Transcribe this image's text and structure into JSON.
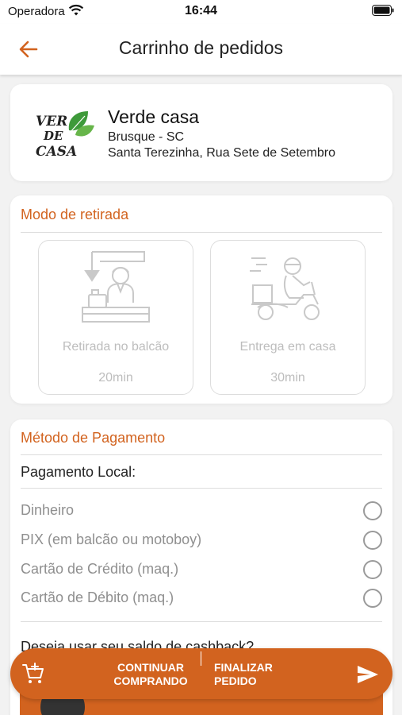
{
  "status_bar": {
    "carrier": "Operadora",
    "time": "16:44"
  },
  "header": {
    "title": "Carrinho de pedidos"
  },
  "store": {
    "logo_line1": "VER",
    "logo_line2": "DE",
    "logo_line3": "CASA",
    "name": "Verde casa",
    "city": "Brusque - SC",
    "address": "Santa Terezinha, Rua Sete de Setembro"
  },
  "pickup": {
    "title": "Modo de retirada",
    "options": [
      {
        "label": "Retirada no balcão",
        "time": "20min"
      },
      {
        "label": "Entrega em casa",
        "time": "30min"
      }
    ]
  },
  "payment": {
    "title": "Método de Pagamento",
    "subtitle": "Pagamento Local:",
    "options": [
      {
        "label": "Dinheiro"
      },
      {
        "label": "PIX (em balcão ou motoboy)"
      },
      {
        "label": "Cartão de Crédito (maq.)"
      },
      {
        "label": "Cartão de Débito (maq.)"
      }
    ],
    "cashback_question": "Deseja usar seu saldo de cashback?"
  },
  "actions": {
    "continue_line1": "CONTINUAR",
    "continue_line2": "COMPRANDO",
    "finalize_line1": "FINALIZAR",
    "finalize_line2": "PEDIDO"
  },
  "colors": {
    "accent": "#d2631f",
    "muted_text": "#bdbdbd",
    "background": "#f2f2f2"
  }
}
